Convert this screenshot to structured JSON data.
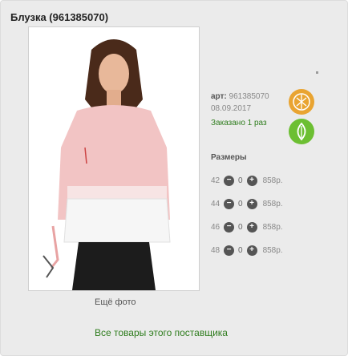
{
  "product": {
    "title": "Блузка (961385070)",
    "art_label": "арт:",
    "art_value": "961385070",
    "date": "08.09.2017",
    "ordered": "Заказано 1 раз",
    "more_photo": "Ещё фото",
    "all_goods_link": "Все товары этого поставщика"
  },
  "sizes": {
    "title": "Размеры",
    "rows": [
      {
        "size": "42",
        "qty": "0",
        "price": "858р."
      },
      {
        "size": "44",
        "qty": "0",
        "price": "858р."
      },
      {
        "size": "46",
        "qty": "0",
        "price": "858р."
      },
      {
        "size": "48",
        "qty": "0",
        "price": "858р."
      }
    ],
    "minus_symbol": "−",
    "plus_symbol": "+"
  },
  "icons": {
    "orange_icon": "leaf-pattern-icon",
    "green_icon": "leaf-icon"
  },
  "colors": {
    "accent_green": "#2f7d1e",
    "icon_orange": "#e9a431",
    "icon_green": "#6cbf32",
    "blouse_pink": "#f2c4c4"
  }
}
